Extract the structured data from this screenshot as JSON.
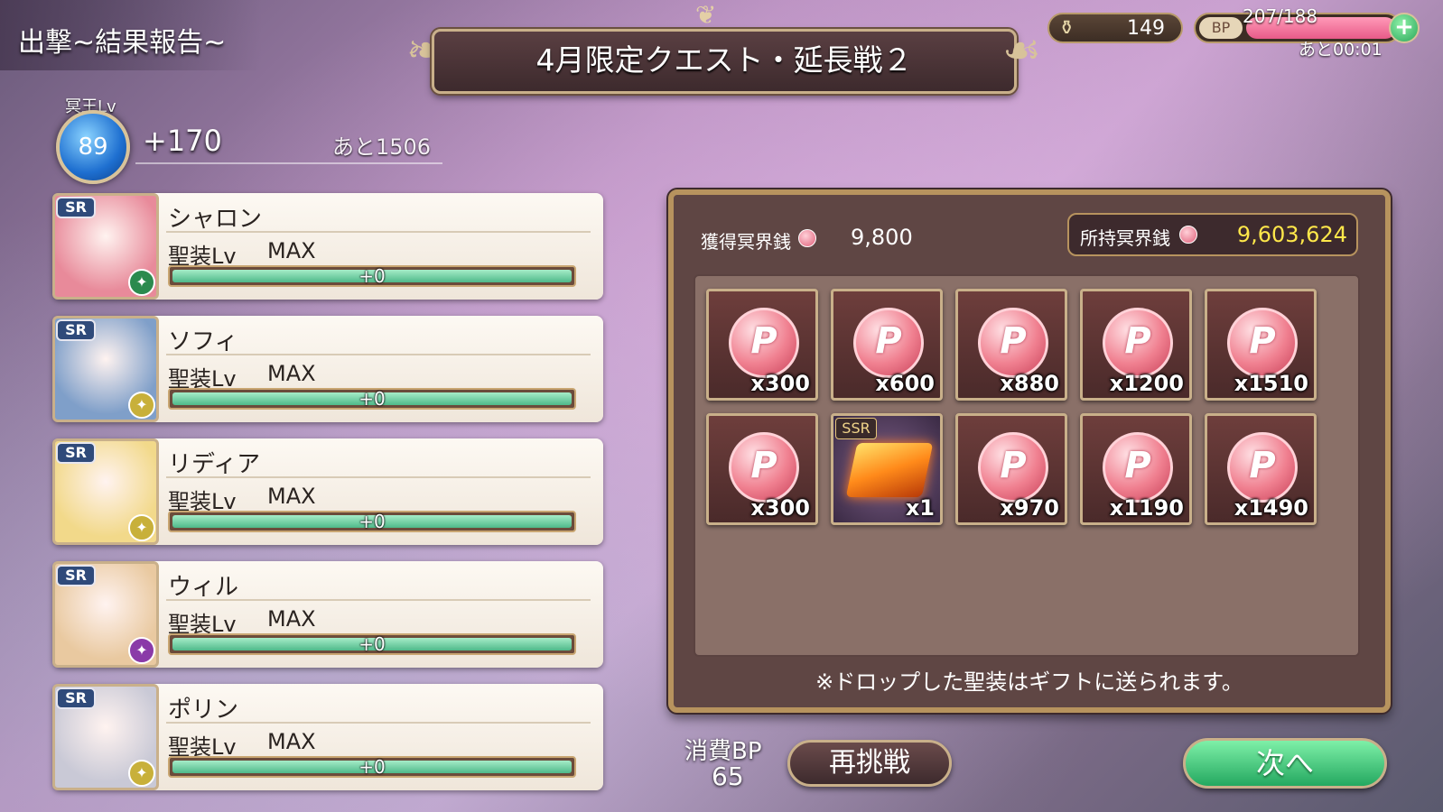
{
  "header": {
    "screen_title": "出撃~結果報告~",
    "quest_title": "4月限定クエスト・延長戦２"
  },
  "top_bar": {
    "stamina_value": "149",
    "stamina_icon": "potion-icon",
    "bp_label": "BP",
    "bp_count": "207/188",
    "bp_fill_fraction": 1.0,
    "bp_timer": "あと00:01",
    "plus_label": "+"
  },
  "player": {
    "level_caption": "冥王Lv",
    "level": "89",
    "gain": "+170",
    "remaining": "あと1506"
  },
  "characters": [
    {
      "rarity": "SR",
      "name": "シャロン",
      "lv_label": "聖装Lv",
      "lv_value": "MAX",
      "bar_text": "+0",
      "bar_fill": 1.0,
      "element_color": "#2b8a4e",
      "element_icon": "leaf-element-icon",
      "portrait_color": "#e88a9a"
    },
    {
      "rarity": "SR",
      "name": "ソフィ",
      "lv_label": "聖装Lv",
      "lv_value": "MAX",
      "bar_text": "+0",
      "bar_fill": 1.0,
      "element_color": "#c8b03a",
      "element_icon": "light-element-icon",
      "portrait_color": "#7f9fc9"
    },
    {
      "rarity": "SR",
      "name": "リディア",
      "lv_label": "聖装Lv",
      "lv_value": "MAX",
      "bar_text": "+0",
      "bar_fill": 1.0,
      "element_color": "#c8b03a",
      "element_icon": "light-element-icon",
      "portrait_color": "#f2d98a"
    },
    {
      "rarity": "SR",
      "name": "ウィル",
      "lv_label": "聖装Lv",
      "lv_value": "MAX",
      "bar_text": "+0",
      "bar_fill": 1.0,
      "element_color": "#8a3aa8",
      "element_icon": "dark-element-icon",
      "portrait_color": "#e9c9a0"
    },
    {
      "rarity": "SR",
      "name": "ポリン",
      "lv_label": "聖装Lv",
      "lv_value": "MAX",
      "bar_text": "+0",
      "bar_fill": 1.0,
      "element_color": "#c8b03a",
      "element_icon": "light-element-icon",
      "portrait_color": "#c9c9d6"
    }
  ],
  "rewards": {
    "earned_label": "獲得冥界銭",
    "earned_value": "9,800",
    "owned_label": "所持冥界銭",
    "owned_value": "9,603,624",
    "items": [
      {
        "kind": "coin",
        "qty": "x300"
      },
      {
        "kind": "coin",
        "qty": "x600"
      },
      {
        "kind": "coin",
        "qty": "x880"
      },
      {
        "kind": "coin",
        "qty": "x1200"
      },
      {
        "kind": "coin",
        "qty": "x1510"
      },
      {
        "kind": "coin",
        "qty": "x300"
      },
      {
        "kind": "gold",
        "qty": "x1",
        "tag": "SSR"
      },
      {
        "kind": "coin",
        "qty": "x970"
      },
      {
        "kind": "coin",
        "qty": "x1190"
      },
      {
        "kind": "coin",
        "qty": "x1490"
      }
    ],
    "note": "※ドロップした聖装はギフトに送られます。"
  },
  "footer": {
    "bp_cost_label": "消費BP",
    "bp_cost_value": "65",
    "retry_label": "再挑戦",
    "next_label": "次へ"
  }
}
